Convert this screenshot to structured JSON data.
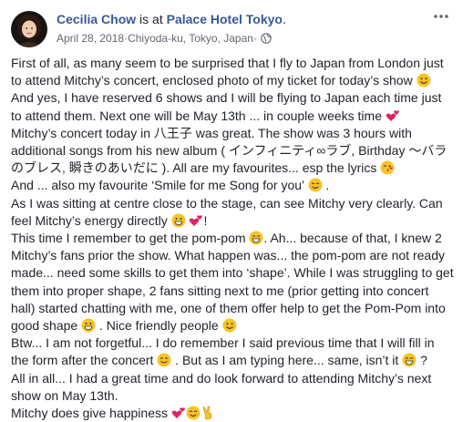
{
  "author": {
    "name": "Cecilia Chow"
  },
  "checkin": {
    "prefix": " is at ",
    "place": "Palace Hotel Tokyo",
    "suffix": "."
  },
  "meta": {
    "date": "April 28, 2018",
    "location": "Chiyoda-ku, Tokyo, Japan",
    "separator": " · "
  },
  "post": {
    "p1a": "First of all, as many seem to be surprised that I fly to Japan from London just to attend Mitchy’s concert, enclosed photo of my ticket for today’s show ",
    "p2a": "And yes, I have reserved 6 shows and I will be flying to Japan each time just to attend them. Next one will be May 13th ... in couple weeks time ",
    "p3a": "Mitchy’s concert today in 八王子 was great. The show was 3 hours with additional songs from his new album ( インフィニティ∞ラブ, Birthday ～バラのブレス, 瞬きのあいだに ). All are my favourites... esp the lyrics ",
    "p4a": "And ... also my favourite ‘Smile for me Song for you’ ",
    "p4b": " .",
    "p5a": "As I was sitting at centre close to the stage, can see Mitchy very clearly. Can feel Mitchy’s energy directly ",
    "p5b": "!",
    "p6a": "This time I remember to get the pom-pom ",
    "p6b": ". Ah... because of that, I knew 2 Mitchy’s fans prior the show. What happen was... the pom-pom are not ready made... need some skills to get them into ‘shape’. While I was struggling to get them into proper shape, 2 fans sitting next to me (prior getting into concert hall) started chatting with me, one of them offer help to get the Pom-Pom into good shape ",
    "p6c": " . Nice friendly people ",
    "p7a": "Btw... I am not forgetful... I do remember I said previous time that I will fill in the form after the concert ",
    "p7b": " . But as I am typing here... same, isn’t it ",
    "p7c": " ?",
    "p8a": "All in all... I had a great time and do look forward to attending Mitchy’s next show on May 13th.",
    "p9a": "Mitchy does give happiness "
  },
  "emoji": {
    "smile_color": "#f7c325",
    "heart_color": "#e0245e",
    "tongue_color": "#e2506a"
  }
}
